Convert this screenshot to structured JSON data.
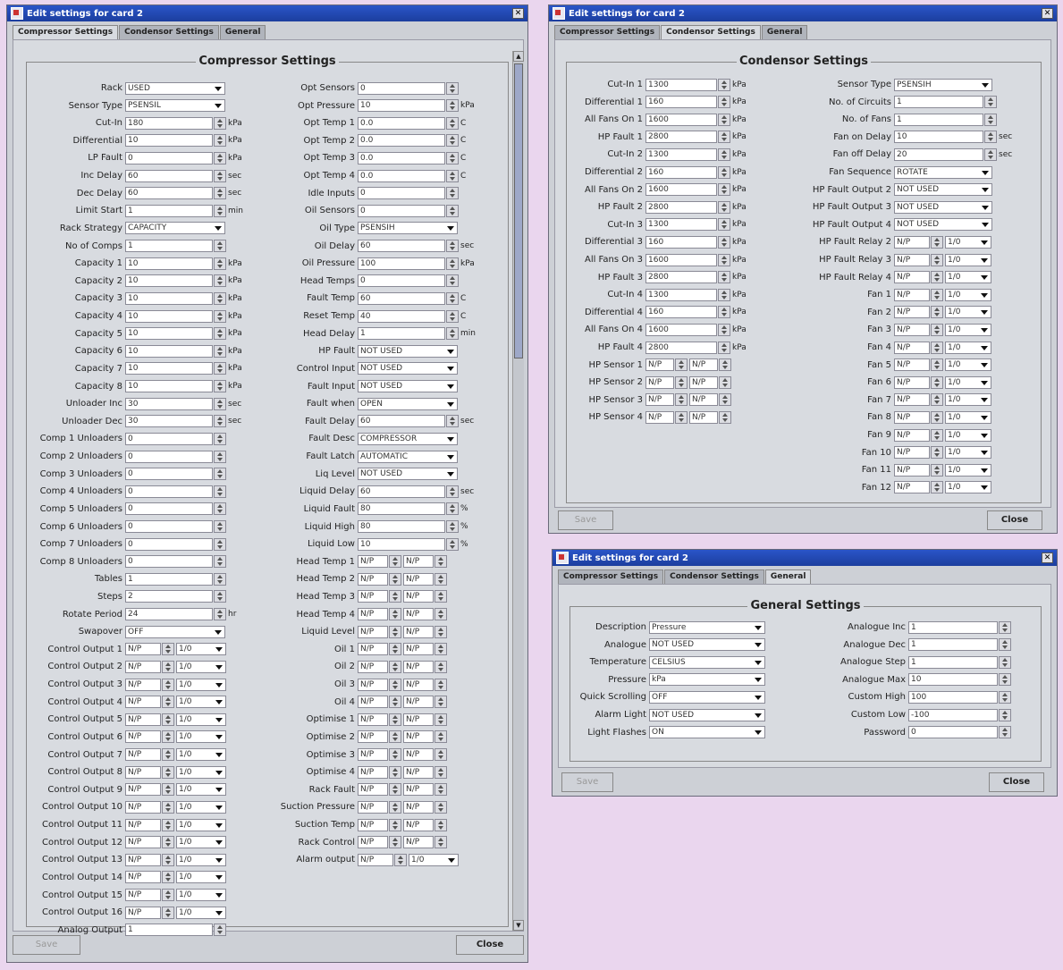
{
  "windows": {
    "compressor": {
      "title": "Edit settings for card 2",
      "tabs": [
        "Compressor Settings",
        "Condensor Settings",
        "General"
      ],
      "group_title": "Compressor Settings",
      "save_label": "Save",
      "close_label": "Close",
      "left": [
        {
          "label": "Rack",
          "type": "select",
          "value": "USED"
        },
        {
          "label": "Sensor Type",
          "type": "select",
          "value": "PSENSIL"
        },
        {
          "label": "Cut-In",
          "type": "spin",
          "value": "180",
          "unit": "kPa"
        },
        {
          "label": "Differential",
          "type": "spin",
          "value": "10",
          "unit": "kPa"
        },
        {
          "label": "LP Fault",
          "type": "spin",
          "value": "0",
          "unit": "kPa"
        },
        {
          "label": "Inc Delay",
          "type": "spin",
          "value": "60",
          "unit": "sec"
        },
        {
          "label": "Dec Delay",
          "type": "spin",
          "value": "60",
          "unit": "sec"
        },
        {
          "label": "Limit Start",
          "type": "spin",
          "value": "1",
          "unit": "min"
        },
        {
          "label": "Rack Strategy",
          "type": "select",
          "value": "CAPACITY"
        },
        {
          "label": "No of Comps",
          "type": "spin",
          "value": "1"
        },
        {
          "label": "Capacity 1",
          "type": "spin",
          "value": "10",
          "unit": "kPa"
        },
        {
          "label": "Capacity 2",
          "type": "spin",
          "value": "10",
          "unit": "kPa"
        },
        {
          "label": "Capacity 3",
          "type": "spin",
          "value": "10",
          "unit": "kPa"
        },
        {
          "label": "Capacity 4",
          "type": "spin",
          "value": "10",
          "unit": "kPa"
        },
        {
          "label": "Capacity 5",
          "type": "spin",
          "value": "10",
          "unit": "kPa"
        },
        {
          "label": "Capacity 6",
          "type": "spin",
          "value": "10",
          "unit": "kPa"
        },
        {
          "label": "Capacity 7",
          "type": "spin",
          "value": "10",
          "unit": "kPa"
        },
        {
          "label": "Capacity 8",
          "type": "spin",
          "value": "10",
          "unit": "kPa"
        },
        {
          "label": "Unloader Inc",
          "type": "spin",
          "value": "30",
          "unit": "sec"
        },
        {
          "label": "Unloader Dec",
          "type": "spin",
          "value": "30",
          "unit": "sec"
        },
        {
          "label": "Comp 1 Unloaders",
          "type": "spin",
          "value": "0"
        },
        {
          "label": "Comp 2 Unloaders",
          "type": "spin",
          "value": "0"
        },
        {
          "label": "Comp 3 Unloaders",
          "type": "spin",
          "value": "0"
        },
        {
          "label": "Comp 4 Unloaders",
          "type": "spin",
          "value": "0"
        },
        {
          "label": "Comp 5 Unloaders",
          "type": "spin",
          "value": "0"
        },
        {
          "label": "Comp 6 Unloaders",
          "type": "spin",
          "value": "0"
        },
        {
          "label": "Comp 7 Unloaders",
          "type": "spin",
          "value": "0"
        },
        {
          "label": "Comp 8 Unloaders",
          "type": "spin",
          "value": "0"
        },
        {
          "label": "Tables",
          "type": "spin",
          "value": "1"
        },
        {
          "label": "Steps",
          "type": "spin",
          "value": "2"
        },
        {
          "label": "Rotate Period",
          "type": "spin",
          "value": "24",
          "unit": "hr"
        },
        {
          "label": "Swapover",
          "type": "select",
          "value": "OFF"
        },
        {
          "label": "Control Output 1",
          "type": "combo",
          "value": "N/P",
          "value2": "1/0"
        },
        {
          "label": "Control Output 2",
          "type": "combo",
          "value": "N/P",
          "value2": "1/0"
        },
        {
          "label": "Control Output 3",
          "type": "combo",
          "value": "N/P",
          "value2": "1/0"
        },
        {
          "label": "Control Output 4",
          "type": "combo",
          "value": "N/P",
          "value2": "1/0"
        },
        {
          "label": "Control Output 5",
          "type": "combo",
          "value": "N/P",
          "value2": "1/0"
        },
        {
          "label": "Control Output 6",
          "type": "combo",
          "value": "N/P",
          "value2": "1/0"
        },
        {
          "label": "Control Output 7",
          "type": "combo",
          "value": "N/P",
          "value2": "1/0"
        },
        {
          "label": "Control Output 8",
          "type": "combo",
          "value": "N/P",
          "value2": "1/0"
        },
        {
          "label": "Control Output 9",
          "type": "combo",
          "value": "N/P",
          "value2": "1/0"
        },
        {
          "label": "Control Output 10",
          "type": "combo",
          "value": "N/P",
          "value2": "1/0"
        },
        {
          "label": "Control Output 11",
          "type": "combo",
          "value": "N/P",
          "value2": "1/0"
        },
        {
          "label": "Control Output 12",
          "type": "combo",
          "value": "N/P",
          "value2": "1/0"
        },
        {
          "label": "Control Output 13",
          "type": "combo",
          "value": "N/P",
          "value2": "1/0"
        },
        {
          "label": "Control Output 14",
          "type": "combo",
          "value": "N/P",
          "value2": "1/0"
        },
        {
          "label": "Control Output 15",
          "type": "combo",
          "value": "N/P",
          "value2": "1/0"
        },
        {
          "label": "Control Output 16",
          "type": "combo",
          "value": "N/P",
          "value2": "1/0"
        },
        {
          "label": "Analog Output",
          "type": "spin",
          "value": "1"
        }
      ],
      "right": [
        {
          "label": "Opt Sensors",
          "type": "spin",
          "value": "0"
        },
        {
          "label": "Opt Pressure",
          "type": "spin",
          "value": "10",
          "unit": "kPa"
        },
        {
          "label": "Opt Temp 1",
          "type": "spin",
          "value": "0.0",
          "unit": "C"
        },
        {
          "label": "Opt Temp 2",
          "type": "spin",
          "value": "0.0",
          "unit": "C"
        },
        {
          "label": "Opt Temp 3",
          "type": "spin",
          "value": "0.0",
          "unit": "C"
        },
        {
          "label": "Opt Temp 4",
          "type": "spin",
          "value": "0.0",
          "unit": "C"
        },
        {
          "label": "Idle Inputs",
          "type": "spin",
          "value": "0"
        },
        {
          "label": "Oil Sensors",
          "type": "spin",
          "value": "0"
        },
        {
          "label": "Oil Type",
          "type": "select",
          "value": "PSENSIH"
        },
        {
          "label": "Oil Delay",
          "type": "spin",
          "value": "60",
          "unit": "sec"
        },
        {
          "label": "Oil Pressure",
          "type": "spin",
          "value": "100",
          "unit": "kPa"
        },
        {
          "label": "Head Temps",
          "type": "spin",
          "value": "0"
        },
        {
          "label": "Fault Temp",
          "type": "spin",
          "value": "60",
          "unit": "C"
        },
        {
          "label": "Reset Temp",
          "type": "spin",
          "value": "40",
          "unit": "C"
        },
        {
          "label": "Head Delay",
          "type": "spin",
          "value": "1",
          "unit": "min"
        },
        {
          "label": "HP Fault",
          "type": "select",
          "value": "NOT USED"
        },
        {
          "label": "Control Input",
          "type": "select",
          "value": "NOT USED"
        },
        {
          "label": "Fault Input",
          "type": "select",
          "value": "NOT USED"
        },
        {
          "label": "Fault when",
          "type": "select",
          "value": "OPEN"
        },
        {
          "label": "Fault Delay",
          "type": "spin",
          "value": "60",
          "unit": "sec"
        },
        {
          "label": "Fault Desc",
          "type": "select",
          "value": "COMPRESSOR"
        },
        {
          "label": "Fault Latch",
          "type": "select",
          "value": "AUTOMATIC"
        },
        {
          "label": "Liq Level",
          "type": "select",
          "value": "NOT USED"
        },
        {
          "label": "Liquid Delay",
          "type": "spin",
          "value": "60",
          "unit": "sec"
        },
        {
          "label": "Liquid Fault",
          "type": "spin",
          "value": "80",
          "unit": "%"
        },
        {
          "label": "Liquid High",
          "type": "spin",
          "value": "80",
          "unit": "%"
        },
        {
          "label": "Liquid Low",
          "type": "spin",
          "value": "10",
          "unit": "%"
        },
        {
          "label": "Head Temp 1",
          "type": "dual",
          "value": "N/P",
          "value2": "N/P"
        },
        {
          "label": "Head Temp 2",
          "type": "dual",
          "value": "N/P",
          "value2": "N/P"
        },
        {
          "label": "Head Temp 3",
          "type": "dual",
          "value": "N/P",
          "value2": "N/P"
        },
        {
          "label": "Head Temp 4",
          "type": "dual",
          "value": "N/P",
          "value2": "N/P"
        },
        {
          "label": "Liquid Level",
          "type": "dual",
          "value": "N/P",
          "value2": "N/P"
        },
        {
          "label": "Oil 1",
          "type": "dual",
          "value": "N/P",
          "value2": "N/P"
        },
        {
          "label": "Oil 2",
          "type": "dual",
          "value": "N/P",
          "value2": "N/P"
        },
        {
          "label": "Oil 3",
          "type": "dual",
          "value": "N/P",
          "value2": "N/P"
        },
        {
          "label": "Oil 4",
          "type": "dual",
          "value": "N/P",
          "value2": "N/P"
        },
        {
          "label": "Optimise 1",
          "type": "dual",
          "value": "N/P",
          "value2": "N/P"
        },
        {
          "label": "Optimise 2",
          "type": "dual",
          "value": "N/P",
          "value2": "N/P"
        },
        {
          "label": "Optimise 3",
          "type": "dual",
          "value": "N/P",
          "value2": "N/P"
        },
        {
          "label": "Optimise 4",
          "type": "dual",
          "value": "N/P",
          "value2": "N/P"
        },
        {
          "label": "Rack Fault",
          "type": "dual",
          "value": "N/P",
          "value2": "N/P"
        },
        {
          "label": "Suction Pressure",
          "type": "dual",
          "value": "N/P",
          "value2": "N/P"
        },
        {
          "label": "Suction Temp",
          "type": "dual",
          "value": "N/P",
          "value2": "N/P"
        },
        {
          "label": "Rack Control",
          "type": "dual",
          "value": "N/P",
          "value2": "N/P"
        },
        {
          "label": "Alarm output",
          "type": "combo",
          "value": "N/P",
          "value2": "1/0"
        }
      ]
    },
    "condensor": {
      "title": "Edit settings for card 2",
      "tabs": [
        "Compressor Settings",
        "Condensor Settings",
        "General"
      ],
      "group_title": "Condensor Settings",
      "save_label": "Save",
      "close_label": "Close",
      "left": [
        {
          "label": "Cut-In 1",
          "type": "spin",
          "value": "1300",
          "unit": "kPa"
        },
        {
          "label": "Differential 1",
          "type": "spin",
          "value": "160",
          "unit": "kPa"
        },
        {
          "label": "All Fans On 1",
          "type": "spin",
          "value": "1600",
          "unit": "kPa"
        },
        {
          "label": "HP Fault 1",
          "type": "spin",
          "value": "2800",
          "unit": "kPa"
        },
        {
          "label": "Cut-In 2",
          "type": "spin",
          "value": "1300",
          "unit": "kPa"
        },
        {
          "label": "Differential 2",
          "type": "spin",
          "value": "160",
          "unit": "kPa"
        },
        {
          "label": "All Fans On 2",
          "type": "spin",
          "value": "1600",
          "unit": "kPa"
        },
        {
          "label": "HP Fault 2",
          "type": "spin",
          "value": "2800",
          "unit": "kPa"
        },
        {
          "label": "Cut-In 3",
          "type": "spin",
          "value": "1300",
          "unit": "kPa"
        },
        {
          "label": "Differential 3",
          "type": "spin",
          "value": "160",
          "unit": "kPa"
        },
        {
          "label": "All Fans On 3",
          "type": "spin",
          "value": "1600",
          "unit": "kPa"
        },
        {
          "label": "HP Fault 3",
          "type": "spin",
          "value": "2800",
          "unit": "kPa"
        },
        {
          "label": "Cut-In 4",
          "type": "spin",
          "value": "1300",
          "unit": "kPa"
        },
        {
          "label": "Differential 4",
          "type": "spin",
          "value": "160",
          "unit": "kPa"
        },
        {
          "label": "All Fans On 4",
          "type": "spin",
          "value": "1600",
          "unit": "kPa"
        },
        {
          "label": "HP Fault 4",
          "type": "spin",
          "value": "2800",
          "unit": "kPa"
        },
        {
          "label": "HP Sensor 1",
          "type": "dual",
          "value": "N/P",
          "value2": "N/P"
        },
        {
          "label": "HP Sensor 2",
          "type": "dual",
          "value": "N/P",
          "value2": "N/P"
        },
        {
          "label": "HP Sensor 3",
          "type": "dual",
          "value": "N/P",
          "value2": "N/P"
        },
        {
          "label": "HP Sensor 4",
          "type": "dual",
          "value": "N/P",
          "value2": "N/P"
        }
      ],
      "right": [
        {
          "label": "Sensor Type",
          "type": "select",
          "value": "PSENSIH"
        },
        {
          "label": "No. of Circuits",
          "type": "spin",
          "value": "1"
        },
        {
          "label": "No. of Fans",
          "type": "spin",
          "value": "1"
        },
        {
          "label": "Fan on Delay",
          "type": "spin",
          "value": "10",
          "unit": "sec"
        },
        {
          "label": "Fan off Delay",
          "type": "spin",
          "value": "20",
          "unit": "sec"
        },
        {
          "label": "Fan Sequence",
          "type": "select",
          "value": "ROTATE"
        },
        {
          "label": "HP Fault Output 2",
          "type": "select",
          "value": "NOT USED"
        },
        {
          "label": "HP Fault Output 3",
          "type": "select",
          "value": "NOT USED"
        },
        {
          "label": "HP Fault Output 4",
          "type": "select",
          "value": "NOT USED"
        },
        {
          "label": "HP Fault Relay 2",
          "type": "combo",
          "value": "N/P",
          "value2": "1/0"
        },
        {
          "label": "HP Fault Relay 3",
          "type": "combo",
          "value": "N/P",
          "value2": "1/0"
        },
        {
          "label": "HP Fault Relay 4",
          "type": "combo",
          "value": "N/P",
          "value2": "1/0"
        },
        {
          "label": "Fan 1",
          "type": "combo",
          "value": "N/P",
          "value2": "1/0"
        },
        {
          "label": "Fan 2",
          "type": "combo",
          "value": "N/P",
          "value2": "1/0"
        },
        {
          "label": "Fan 3",
          "type": "combo",
          "value": "N/P",
          "value2": "1/0"
        },
        {
          "label": "Fan 4",
          "type": "combo",
          "value": "N/P",
          "value2": "1/0"
        },
        {
          "label": "Fan 5",
          "type": "combo",
          "value": "N/P",
          "value2": "1/0"
        },
        {
          "label": "Fan 6",
          "type": "combo",
          "value": "N/P",
          "value2": "1/0"
        },
        {
          "label": "Fan 7",
          "type": "combo",
          "value": "N/P",
          "value2": "1/0"
        },
        {
          "label": "Fan 8",
          "type": "combo",
          "value": "N/P",
          "value2": "1/0"
        },
        {
          "label": "Fan 9",
          "type": "combo",
          "value": "N/P",
          "value2": "1/0"
        },
        {
          "label": "Fan 10",
          "type": "combo",
          "value": "N/P",
          "value2": "1/0"
        },
        {
          "label": "Fan 11",
          "type": "combo",
          "value": "N/P",
          "value2": "1/0"
        },
        {
          "label": "Fan 12",
          "type": "combo",
          "value": "N/P",
          "value2": "1/0"
        }
      ]
    },
    "general": {
      "title": "Edit settings for card 2",
      "tabs": [
        "Compressor Settings",
        "Condensor Settings",
        "General"
      ],
      "group_title": "General Settings",
      "save_label": "Save",
      "close_label": "Close",
      "left": [
        {
          "label": "Description",
          "type": "select",
          "value": "Pressure"
        },
        {
          "label": "Analogue",
          "type": "select",
          "value": "NOT USED"
        },
        {
          "label": "Temperature",
          "type": "select",
          "value": "CELSIUS"
        },
        {
          "label": "Pressure",
          "type": "select",
          "value": "kPa"
        },
        {
          "label": "Quick Scrolling",
          "type": "select",
          "value": "OFF"
        },
        {
          "label": "Alarm Light",
          "type": "select",
          "value": "NOT USED"
        },
        {
          "label": "Light Flashes",
          "type": "select",
          "value": "ON"
        }
      ],
      "right": [
        {
          "label": "Analogue Inc",
          "type": "spin",
          "value": "1"
        },
        {
          "label": "Analogue Dec",
          "type": "spin",
          "value": "1"
        },
        {
          "label": "Analogue Step",
          "type": "spin",
          "value": "1"
        },
        {
          "label": "Analogue Max",
          "type": "spin",
          "value": "10"
        },
        {
          "label": "Custom High",
          "type": "spin",
          "value": "100"
        },
        {
          "label": "Custom Low",
          "type": "spin",
          "value": "-100"
        },
        {
          "label": "Password",
          "type": "spin",
          "value": "0"
        }
      ]
    }
  }
}
